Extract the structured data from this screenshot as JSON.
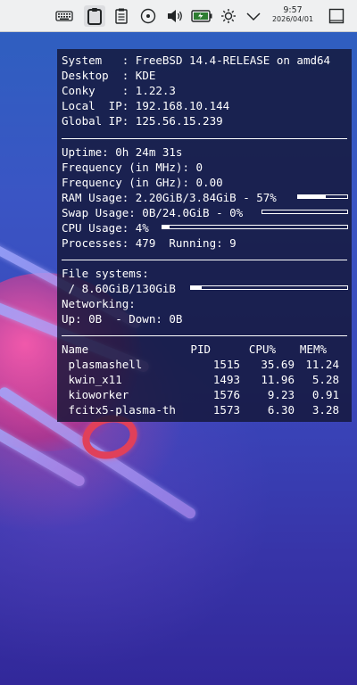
{
  "panel": {
    "clock_time": "9:57",
    "clock_date": "2026/04/01",
    "icons": [
      "keyboard-icon",
      "clipboard-icon",
      "notes-icon",
      "media-disc-icon",
      "volume-icon",
      "battery-icon",
      "brightness-icon",
      "chevron-down-icon",
      "show-desktop-icon"
    ]
  },
  "conky": {
    "sys_label": "System   :",
    "sys_value": "FreeBSD 14.4-RELEASE on amd64",
    "desktop_label": "Desktop  :",
    "desktop_value": "KDE",
    "conky_label": "Conky    :",
    "conky_value": "1.22.3",
    "local_ip_label": "Local  IP:",
    "local_ip_value": "192.168.10.144",
    "global_ip_label": "Global IP:",
    "global_ip_value": "125.56.15.239",
    "uptime": "Uptime: 0h 24m 31s",
    "freq_mhz": "Frequency (in MHz): 0",
    "freq_ghz": "Frequency (in GHz): 0.00",
    "ram": "RAM Usage: 2.20GiB/3.84GiB - 57%",
    "ram_fraction": 0.57,
    "swap": "Swap Usage: 0B/24.0GiB - 0%",
    "swap_fraction": 0.0,
    "cpu": "CPU Usage: 4%",
    "cpu_fraction": 0.04,
    "processes": "Processes: 479  Running: 9",
    "fs_title": "File systems:",
    "fs_root": " / 8.60GiB/130GiB",
    "fs_fraction": 0.066,
    "net_title": "Networking:",
    "net_rates": "Up: 0B  - Down: 0B",
    "proc_headers": {
      "name": "Name",
      "pid": "PID",
      "cpu": "CPU%",
      "mem": "MEM%"
    },
    "procs": [
      {
        "name": " plasmashell",
        "pid": "1515",
        "cpu": "35.69",
        "mem": "11.24"
      },
      {
        "name": " kwin_x11",
        "pid": "1493",
        "cpu": "11.96",
        "mem": "5.28"
      },
      {
        "name": " kioworker",
        "pid": "1576",
        "cpu": "9.23",
        "mem": "0.91"
      },
      {
        "name": " fcitx5-plasma-th",
        "pid": "1573",
        "cpu": "6.30",
        "mem": "3.28"
      }
    ]
  }
}
